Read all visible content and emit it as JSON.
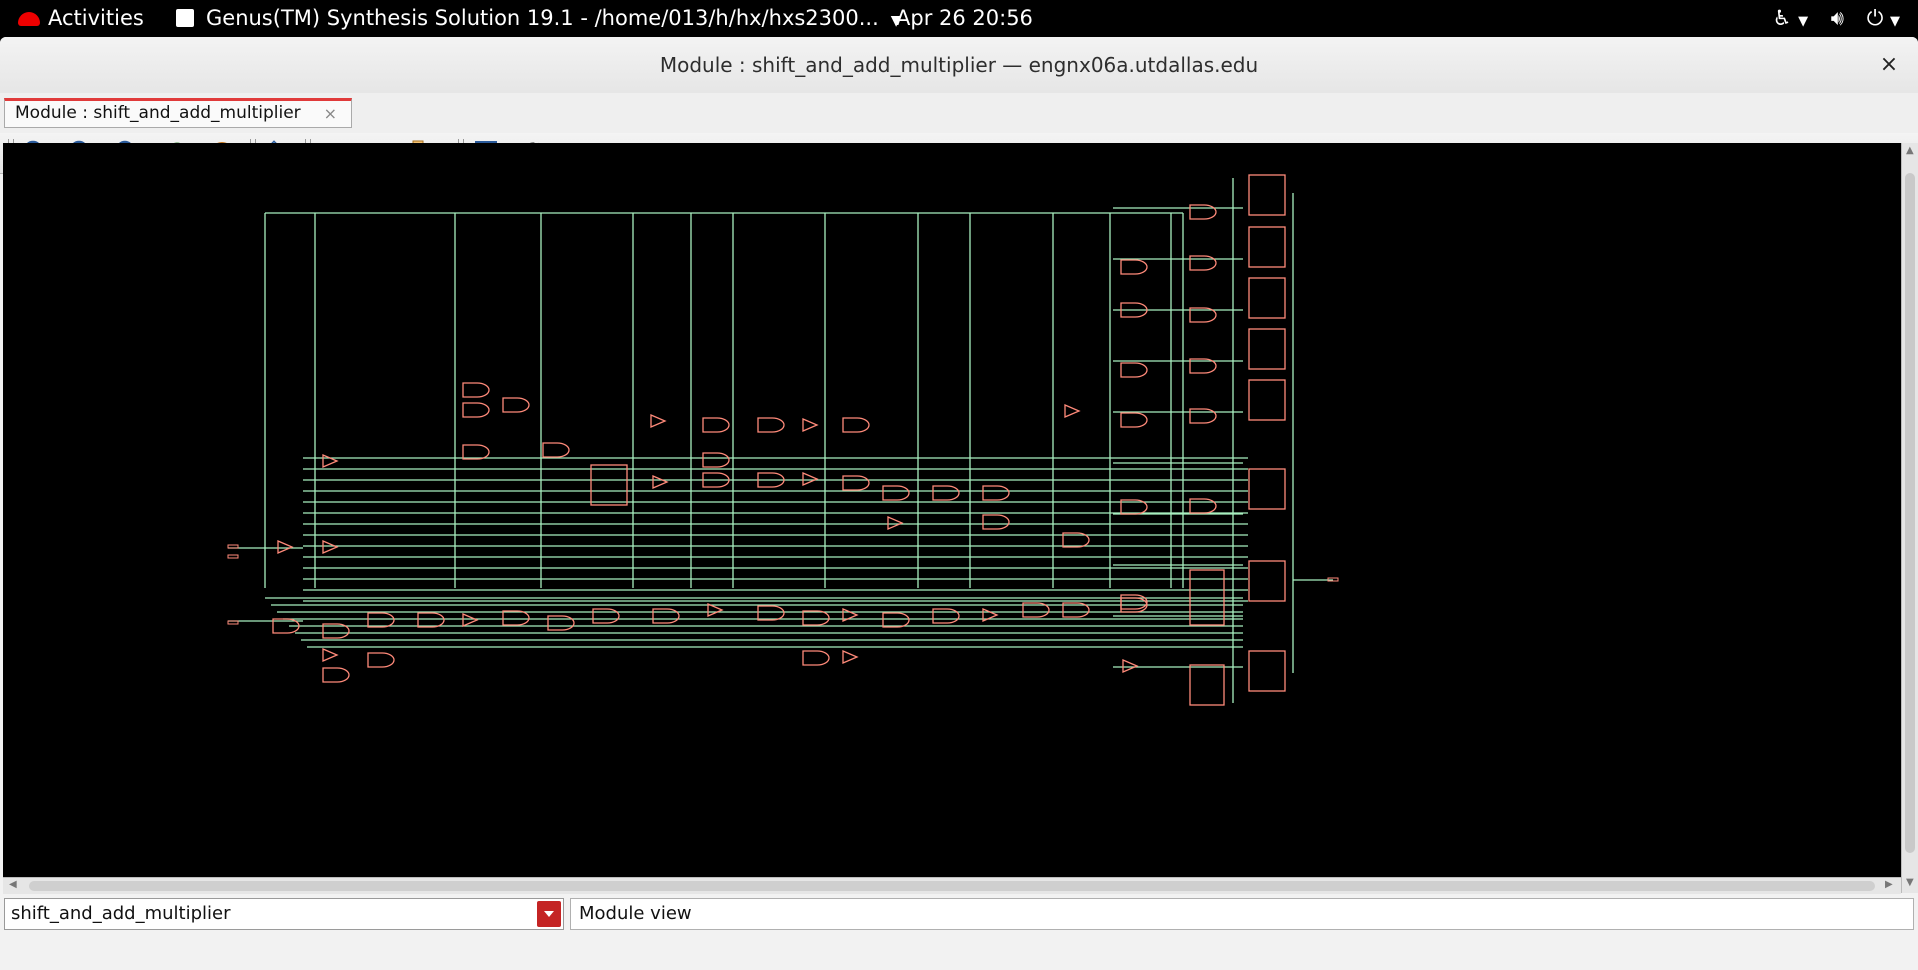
{
  "topbar": {
    "activities": "Activities",
    "app_menu": "Genus(TM) Synthesis Solution 19.1 - /home/013/h/hx/hxs2300...",
    "clock": "Apr 26  20:56",
    "icons": [
      "accessibility-icon",
      "volume-icon",
      "power-icon"
    ]
  },
  "window": {
    "title": "Module : shift_and_add_multiplier — engnx06a.utdallas.edu",
    "close": "×"
  },
  "tabs": [
    {
      "label": "Module : shift_and_add_multiplier",
      "close": "×",
      "active": true
    }
  ],
  "toolbar": {
    "buttons": [
      "zoom-in-icon",
      "zoom-out-icon",
      "zoom-fit-icon",
      "refresh-icon",
      "stop-icon",
      "hierarchy-up-icon",
      "back-icon",
      "forward-icon",
      "schematic-layout-icon",
      "select-icon",
      "settings-icon"
    ]
  },
  "schematic": {
    "background": "#000000",
    "wire_color": "#a8f0c0",
    "cell_color": "#ff8a7a"
  },
  "statusbar": {
    "module_selector": "shift_and_add_multiplier",
    "view": "Module view"
  },
  "colors": {
    "accent_red": "#c42424",
    "tab_highlight": "#e03a3a"
  }
}
